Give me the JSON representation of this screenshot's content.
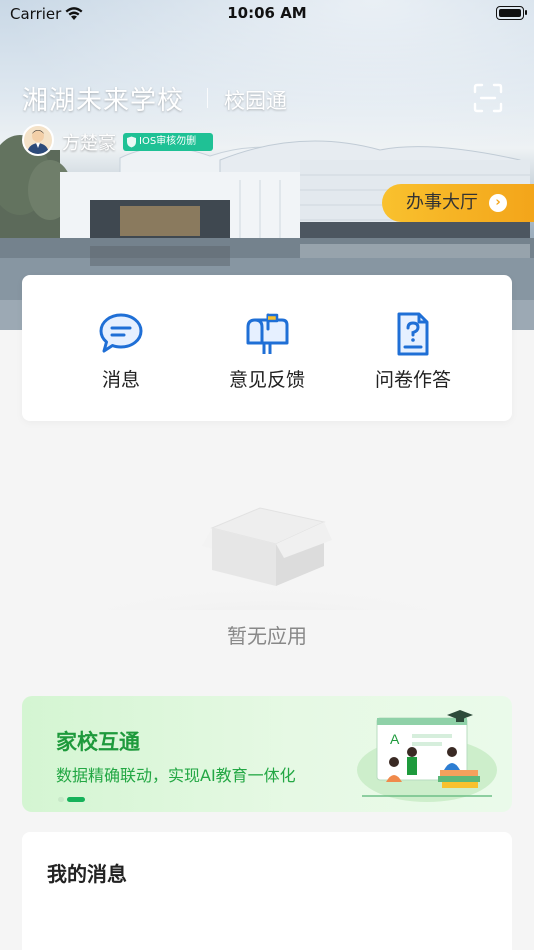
{
  "status_bar": {
    "carrier": "Carrier",
    "time": "10:06 AM"
  },
  "header": {
    "school_name": "湘湖未来学校",
    "app_name": "校园通",
    "scan_icon": "scan-icon"
  },
  "user": {
    "name": "方楚豪",
    "badge": "IOS审核勿删"
  },
  "office_button": {
    "label": "办事大厅",
    "arrow": "›"
  },
  "quick_actions": [
    {
      "label": "消息",
      "icon": "message-bubble-icon"
    },
    {
      "label": "意见反馈",
      "icon": "mailbox-icon"
    },
    {
      "label": "问卷作答",
      "icon": "question-document-icon"
    }
  ],
  "empty_state": {
    "text": "暂无应用",
    "icon": "empty-box-icon"
  },
  "banner": {
    "title": "家校互通",
    "subtitle": "数据精确联动，实现AI教育一体化",
    "illustration_letter": "A",
    "page_count": 2,
    "active_page": 2
  },
  "messages": {
    "title": "我的消息"
  },
  "colors": {
    "accent_blue": "#1f6fd6",
    "office_yellow": "#f9c12e",
    "badge_green": "#1fc195",
    "banner_green": "#1e9a3c"
  }
}
